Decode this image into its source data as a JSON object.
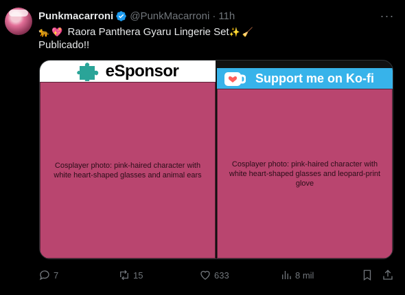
{
  "author": {
    "name": "Punkmacarroni",
    "handle": "@PunkMacarroni",
    "separator": "·",
    "time": "11h"
  },
  "tweet": {
    "line1_emoji": [
      "🐆",
      "💖"
    ],
    "line1_text": "Raora Panthera Gyaru Lingerie Set",
    "line1_trailing_emoji": [
      "✨",
      "🧹"
    ],
    "line2_text": "Publicado!!"
  },
  "media": {
    "left_banner": "eSponsor",
    "left_photo": "Cosplayer photo: pink-haired character with white heart-shaped glasses and animal ears",
    "right_banner": "Support me on Ko-fi",
    "right_photo": "Cosplayer photo: pink-haired character with white heart-shaped glasses and leopard-print glove"
  },
  "actions": {
    "replies": "7",
    "retweets": "15",
    "likes": "633",
    "views": "8 mil"
  },
  "colors": {
    "background": "#000000",
    "secondary_text": "#71767b",
    "verified": "#1d9bf0",
    "kofi_blue": "#37b3ea",
    "esponsor_teal": "#2aa498"
  }
}
